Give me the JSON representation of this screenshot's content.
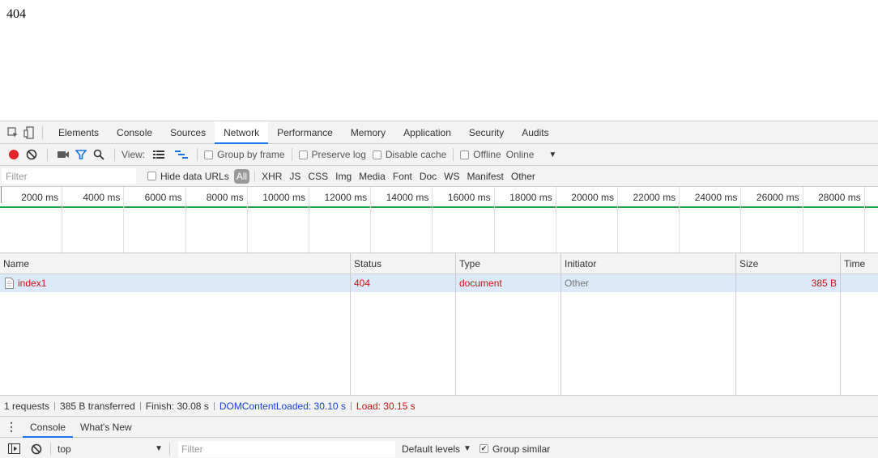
{
  "page": {
    "text": "404"
  },
  "devtools": {
    "tabs": [
      "Elements",
      "Console",
      "Sources",
      "Network",
      "Performance",
      "Memory",
      "Application",
      "Security",
      "Audits"
    ],
    "active_tab": "Network",
    "toolbar": {
      "view_label": "View:",
      "group_by_frame": "Group by frame",
      "preserve_log": "Preserve log",
      "disable_cache": "Disable cache",
      "offline": "Offline",
      "throttle": "Online"
    },
    "filterbar": {
      "filter_placeholder": "Filter",
      "hide_data_urls": "Hide data URLs",
      "all": "All",
      "types": [
        "XHR",
        "JS",
        "CSS",
        "Img",
        "Media",
        "Font",
        "Doc",
        "WS",
        "Manifest",
        "Other"
      ]
    },
    "overview": {
      "ticks": [
        "2000 ms",
        "4000 ms",
        "6000 ms",
        "8000 ms",
        "10000 ms",
        "12000 ms",
        "14000 ms",
        "16000 ms",
        "18000 ms",
        "20000 ms",
        "22000 ms",
        "24000 ms",
        "26000 ms",
        "28000 ms"
      ]
    },
    "table": {
      "columns": [
        "Name",
        "Status",
        "Type",
        "Initiator",
        "Size",
        "Time"
      ],
      "rows": [
        {
          "name": "index1",
          "status": "404",
          "type": "document",
          "initiator": "Other",
          "size": "385 B",
          "time": ""
        }
      ]
    },
    "summary": {
      "requests": "1 requests",
      "transferred": "385 B transferred",
      "finish": "Finish: 30.08 s",
      "dom_content_loaded": "DOMContentLoaded: 30.10 s",
      "load": "Load: 30.15 s"
    },
    "drawer": {
      "tabs": [
        "Console",
        "What's New"
      ],
      "active_tab": "Console",
      "context": "top",
      "filter_placeholder": "Filter",
      "levels": "Default levels",
      "group_similar": "Group similar"
    }
  },
  "colors": {
    "accent": "#1a73e8",
    "error": "#d21010",
    "timeline_green": "#1ea446",
    "selected_row": "#dbe9f9"
  }
}
